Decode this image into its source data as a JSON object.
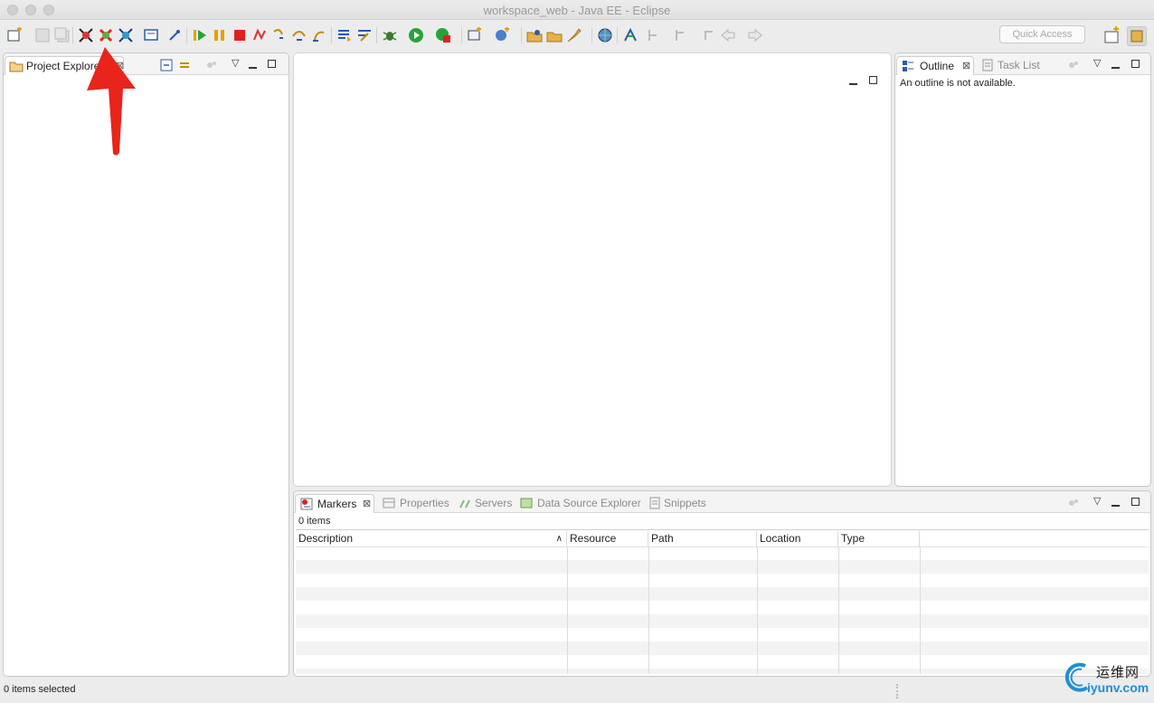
{
  "window": {
    "title": "workspace_web - Java EE - Eclipse"
  },
  "toolbar": {
    "quick_access_placeholder": "Quick Access",
    "icons": [
      "new-icon",
      "save-icon",
      "save-all-icon",
      "skip-breakpoints-icon",
      "remove-breakpoints-icon",
      "remote-debug-icon",
      "console-icon",
      "pin-icon",
      "resume-icon",
      "suspend-icon",
      "terminate-icon",
      "disconnect-icon",
      "step-into-icon",
      "step-over-icon",
      "step-return-icon",
      "drop-frame-icon",
      "use-step-filters-icon",
      "debug-icon",
      "run-icon",
      "run-last-icon",
      "new-server-icon",
      "new-web-service-icon",
      "open-type-icon",
      "open-task-icon",
      "search-icon",
      "globe-icon",
      "annotation-icon",
      "next-annotation-icon",
      "last-edit-icon",
      "back-icon",
      "forward-icon"
    ]
  },
  "project_explorer": {
    "tab_label": "Project Explorer"
  },
  "outline": {
    "tab_label": "Outline",
    "tab2_label": "Task List",
    "message": "An outline is not available."
  },
  "bottom": {
    "tabs": [
      "Markers",
      "Properties",
      "Servers",
      "Data Source Explorer",
      "Snippets"
    ],
    "count_label": "0 items",
    "columns": [
      "Description",
      "Resource",
      "Path",
      "Location",
      "Type"
    ]
  },
  "status_bar": {
    "text": "0 items selected"
  },
  "watermark": {
    "text": "运维网",
    "url_text": "iyunv.com"
  },
  "colors": {
    "accent_red": "#e8241b",
    "tab_active_bg": "#ffffff",
    "panel_border": "#c8c8c8"
  }
}
